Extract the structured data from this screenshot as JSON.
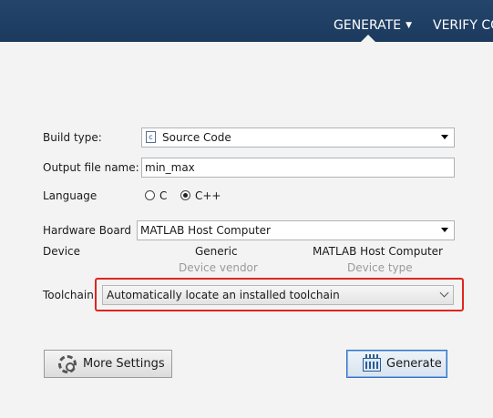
{
  "header": {
    "tabs": [
      {
        "label": "GENERATE"
      },
      {
        "label": "VERIFY CO"
      }
    ]
  },
  "form": {
    "build_type": {
      "label": "Build type:",
      "value": "Source Code",
      "icon": "c-file-icon"
    },
    "output_file": {
      "label": "Output file name:",
      "value": "min_max"
    },
    "language": {
      "label": "Language",
      "options": [
        {
          "label": "C",
          "selected": false
        },
        {
          "label": "C++",
          "selected": true
        }
      ]
    },
    "hardware_board": {
      "label": "Hardware Board",
      "value": "MATLAB Host Computer"
    },
    "device": {
      "label": "Device",
      "vendor_value": "Generic",
      "vendor_caption": "Device vendor",
      "type_value": "MATLAB Host Computer",
      "type_caption": "Device type"
    },
    "toolchain": {
      "label": "Toolchain",
      "value": "Automatically locate an installed toolchain"
    }
  },
  "buttons": {
    "more_settings": "More Settings",
    "generate": "Generate"
  },
  "colors": {
    "header_bg": "#1c3a5e",
    "highlight_border": "#e0251f",
    "primary_button_border": "#2f73c7"
  }
}
